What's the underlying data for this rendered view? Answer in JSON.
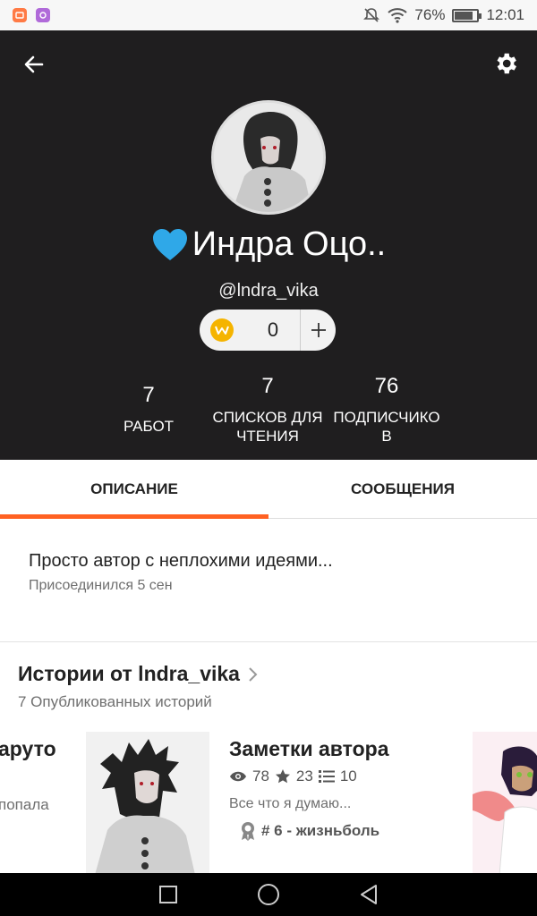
{
  "status_bar": {
    "battery_percent": "76%",
    "battery_level": 0.76,
    "time": "12:01",
    "icons": [
      "app-icon-orange",
      "app-icon-purple",
      "mute-icon",
      "wifi-icon",
      "battery-icon"
    ]
  },
  "profile": {
    "name": "Индра Оцо..",
    "handle": "@lndra_vika",
    "coins": "0",
    "heart_color": "#2fa8e8",
    "stats": [
      {
        "value": "7",
        "label": "РАБОТ"
      },
      {
        "value": "7",
        "label": "СПИСКОВ ДЛЯ ЧТЕНИЯ"
      },
      {
        "value": "76",
        "label": "ПОДПИСЧИКО В"
      }
    ]
  },
  "tabs": [
    {
      "label": "ОПИСАНИЕ",
      "active": true
    },
    {
      "label": "СООБЩЕНИЯ",
      "active": false
    }
  ],
  "accent_color": "#ff6122",
  "about": {
    "description": "Просто автор с неплохими идеями...",
    "joined": "Присоединился 5 сен"
  },
  "stories": {
    "title": "Истории от lndra_vika",
    "subtitle": "7 Опубликованных историй",
    "previous": {
      "title": "аруто",
      "desc": "попала"
    },
    "current": {
      "title": "Заметки автора",
      "views": "78",
      "votes": "23",
      "parts": "10",
      "desc": "Все что я думаю...",
      "rank": "# 6 - жизньболь"
    }
  },
  "nav": {
    "icons": [
      "recent-apps-icon",
      "home-icon",
      "back-nav-icon"
    ]
  }
}
